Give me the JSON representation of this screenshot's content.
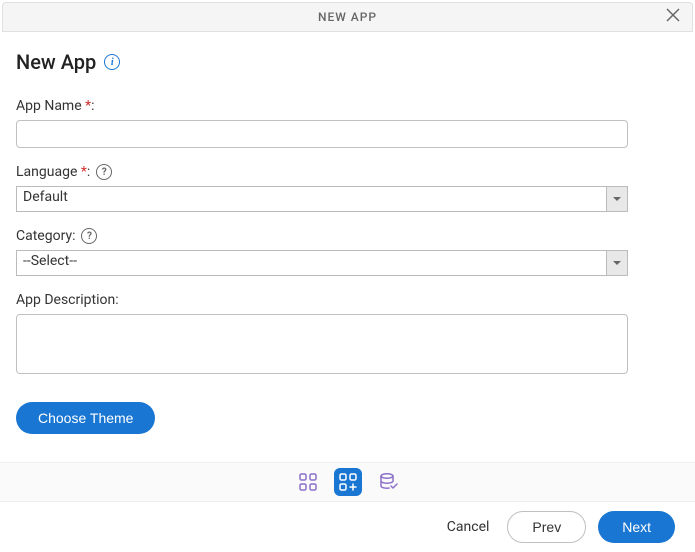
{
  "header": {
    "title": "NEW APP"
  },
  "page": {
    "title": "New App"
  },
  "form": {
    "appName": {
      "label": "App Name",
      "value": ""
    },
    "language": {
      "label": "Language",
      "value": "Default"
    },
    "category": {
      "label": "Category:",
      "value": "--Select--"
    },
    "description": {
      "label": "App Description:",
      "value": ""
    },
    "themeButton": "Choose Theme"
  },
  "footer": {
    "cancel": "Cancel",
    "prev": "Prev",
    "next": "Next"
  }
}
